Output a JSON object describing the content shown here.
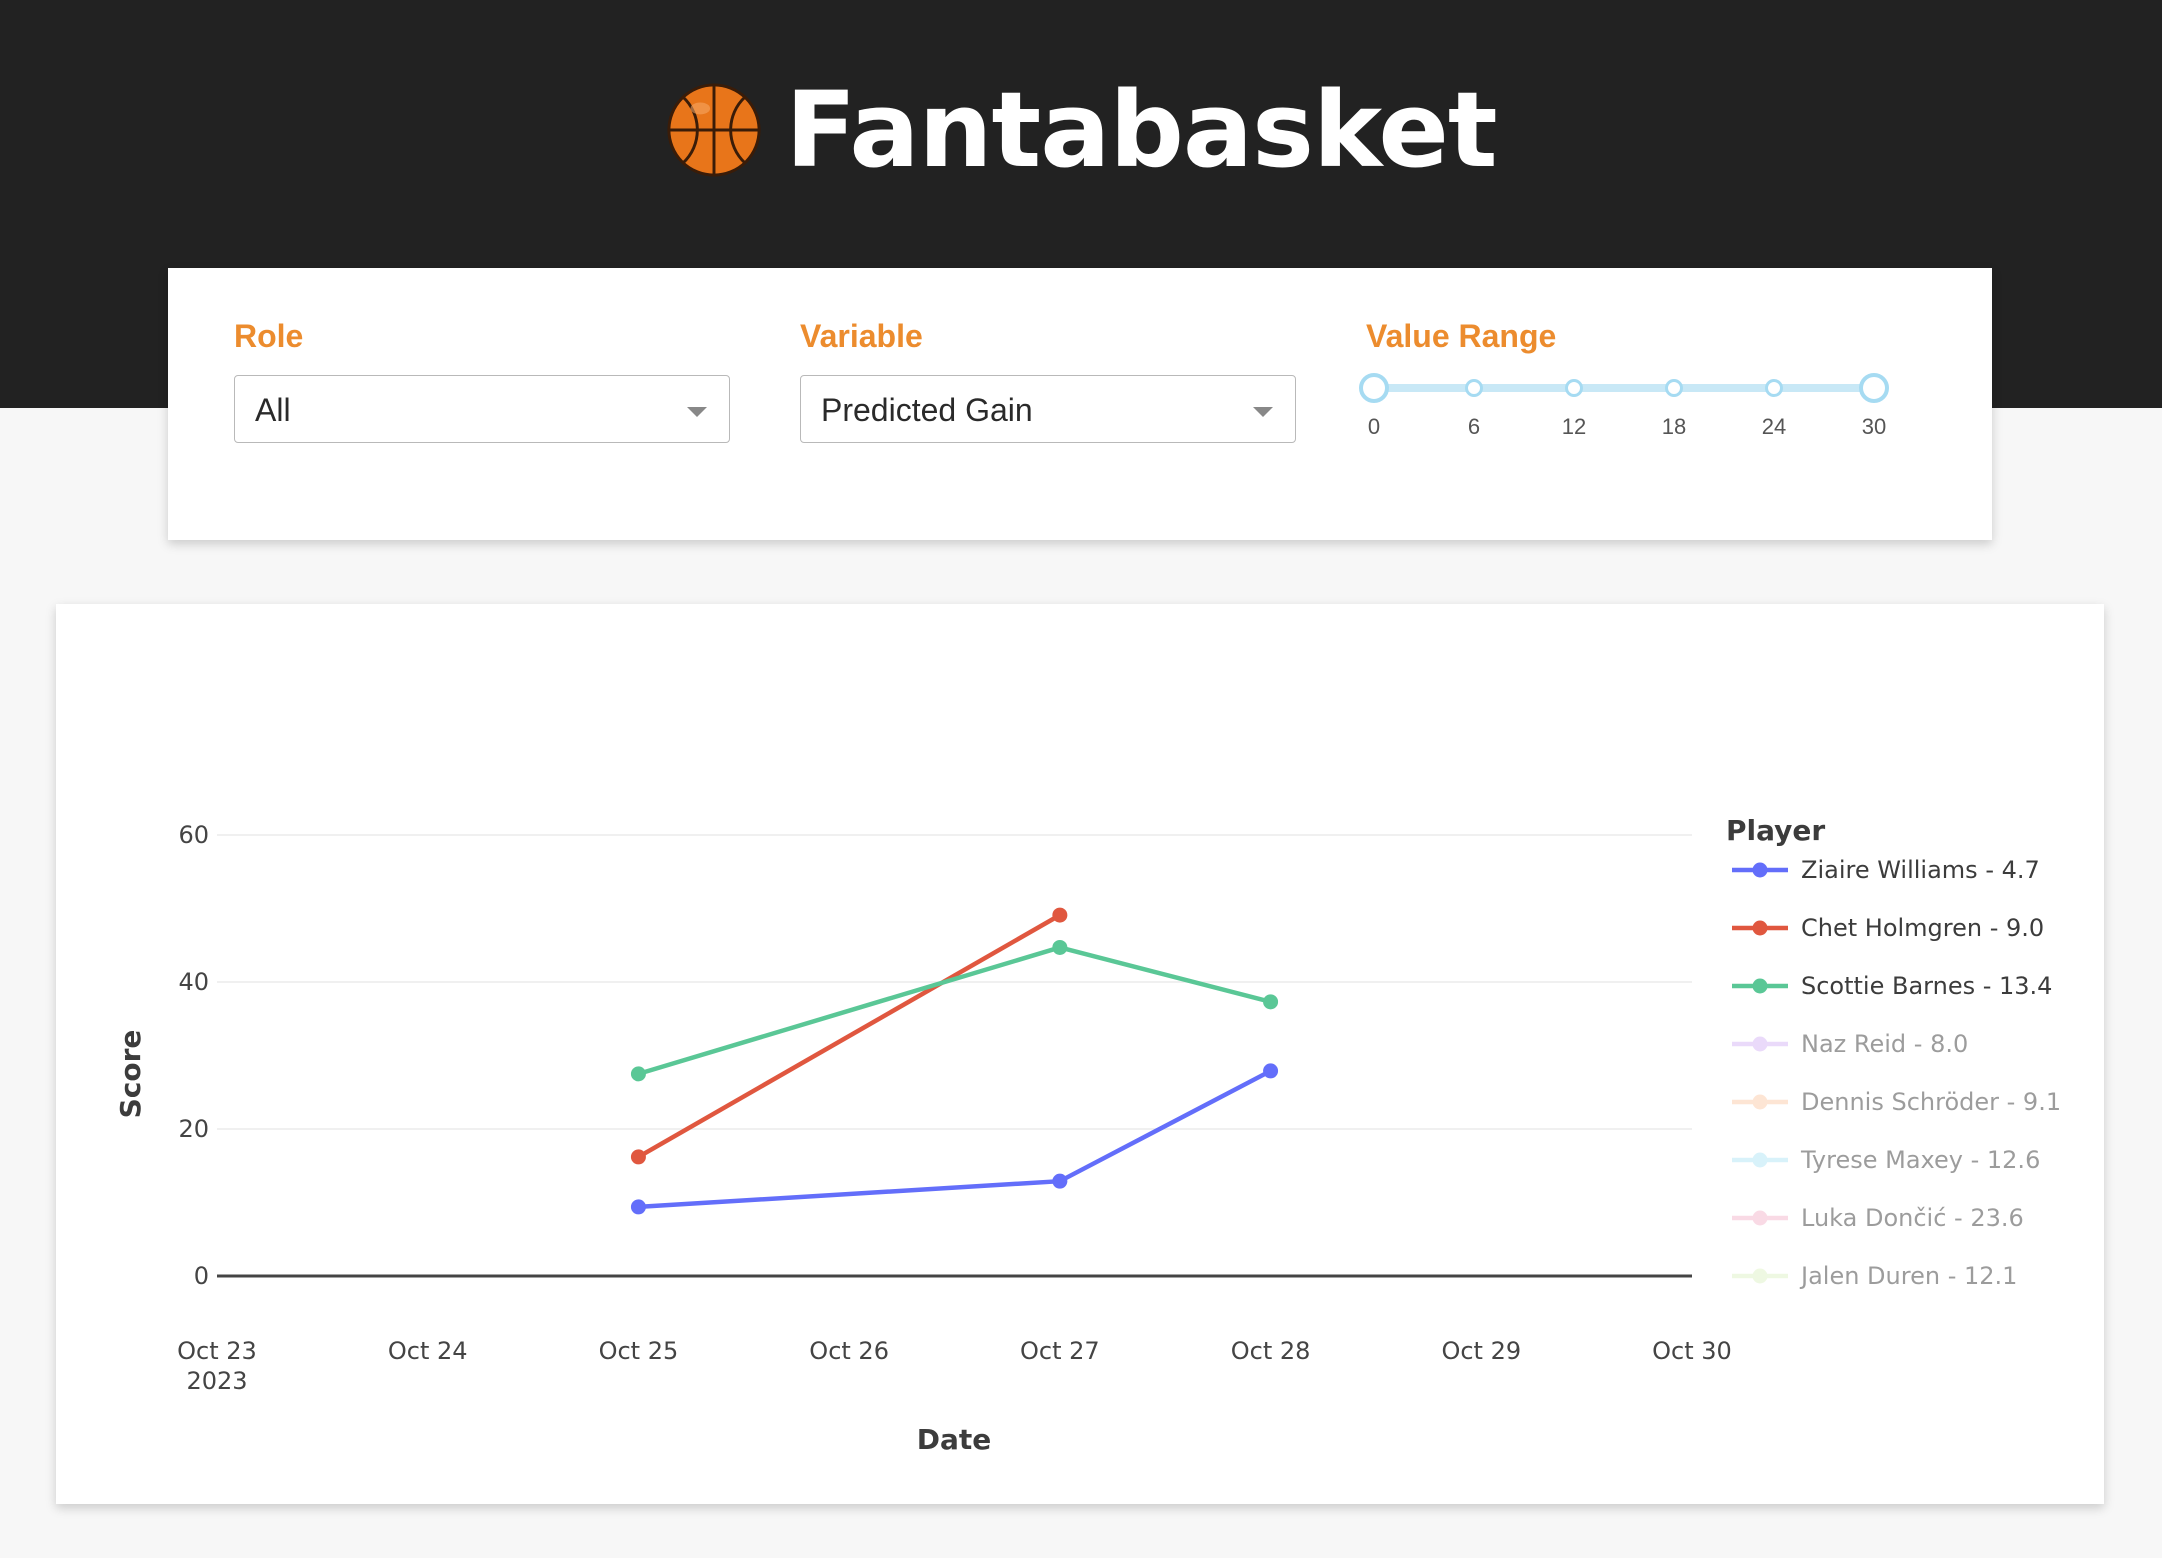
{
  "app": {
    "title": "Fantabasket",
    "logo_icon": "basketball-icon"
  },
  "filters": {
    "role": {
      "label": "Role",
      "value": "All"
    },
    "variable": {
      "label": "Variable",
      "value": "Predicted Gain"
    },
    "value_range": {
      "label": "Value Range",
      "min": 0,
      "max": 30,
      "selected": [
        0,
        30
      ],
      "ticks": [
        "0",
        "6",
        "12",
        "18",
        "24",
        "30"
      ]
    }
  },
  "colors": {
    "header_bg": "#222222",
    "accent": "#ec8c2e",
    "slider": "#a6dbf2"
  },
  "chart_data": {
    "type": "line",
    "xlabel": "Date",
    "ylabel": "Score",
    "x_ticks": [
      "Oct 23",
      "Oct 24",
      "Oct 25",
      "Oct 26",
      "Oct 27",
      "Oct 28",
      "Oct 29",
      "Oct 30"
    ],
    "x_tick_year": "2023",
    "xlim": [
      "2023-10-23",
      "2023-10-30"
    ],
    "y_ticks": [
      0,
      20,
      40,
      60
    ],
    "ylim": [
      0,
      60
    ],
    "grid": true,
    "legend_title": "Player",
    "legend_position": "right",
    "series": [
      {
        "name": "Ziaire Williams - 4.7",
        "color": "#636efa",
        "active": true,
        "points": [
          [
            "2023-10-25",
            9.4
          ],
          [
            "2023-10-27",
            12.9
          ],
          [
            "2023-10-28",
            27.9
          ]
        ]
      },
      {
        "name": "Chet Holmgren - 9.0",
        "color": "#e0573f",
        "active": true,
        "points": [
          [
            "2023-10-25",
            16.2
          ],
          [
            "2023-10-27",
            49.1
          ]
        ]
      },
      {
        "name": "Scottie Barnes - 13.4",
        "color": "#5ac796",
        "active": true,
        "points": [
          [
            "2023-10-25",
            27.5
          ],
          [
            "2023-10-27",
            44.7
          ],
          [
            "2023-10-28",
            37.3
          ]
        ]
      },
      {
        "name": "Naz Reid - 8.0",
        "color": "#d6b7f6",
        "active": false,
        "points": []
      },
      {
        "name": "Dennis Schröder - 9.1",
        "color": "#fcccab",
        "active": false,
        "points": []
      },
      {
        "name": "Tyrese Maxey - 12.6",
        "color": "#b3e6f7",
        "active": false,
        "points": []
      },
      {
        "name": "Luka Dončić - 23.6",
        "color": "#f5b6cd",
        "active": false,
        "points": []
      },
      {
        "name": "Jalen Duren - 12.1",
        "color": "#dff3c6",
        "active": false,
        "points": []
      }
    ]
  }
}
